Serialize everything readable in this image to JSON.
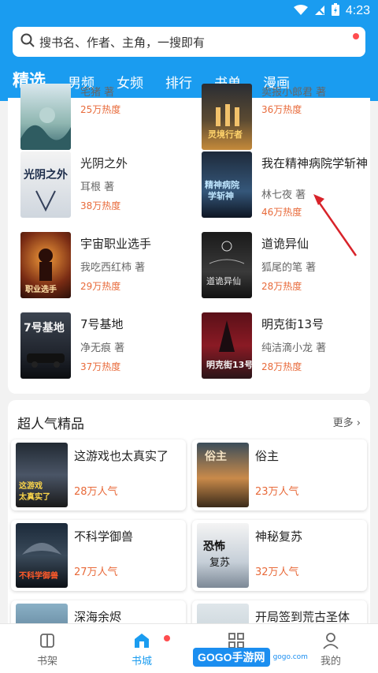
{
  "status_bar": {
    "time": "4:23"
  },
  "search": {
    "placeholder": "搜书名、作者、主角，一搜即有"
  },
  "tabs": [
    {
      "label": "精选",
      "active": true
    },
    {
      "label": "男频"
    },
    {
      "label": "女频"
    },
    {
      "label": "排行"
    },
    {
      "label": "书单"
    },
    {
      "label": "漫画"
    }
  ],
  "ranked_books": [
    {
      "title": "",
      "author": "宅猪 著",
      "heat": "25万热度"
    },
    {
      "title": "",
      "author": "卖报小郎君 著",
      "heat": "36万热度"
    },
    {
      "title": "光阴之外",
      "author": "耳根 著",
      "heat": "38万热度"
    },
    {
      "title": "我在精神病院学斩神",
      "author": "林七夜 著",
      "heat": "46万热度"
    },
    {
      "title": "宇宙职业选手",
      "author": "我吃西红柿 著",
      "heat": "29万热度"
    },
    {
      "title": "道诡异仙",
      "author": "狐尾的笔 著",
      "heat": "28万热度"
    },
    {
      "title": "7号基地",
      "author": "净无痕 著",
      "heat": "37万热度"
    },
    {
      "title": "明克街13号",
      "author": "纯洁滴小龙 著",
      "heat": "28万热度"
    }
  ],
  "popular_section": {
    "heading": "超人气精品",
    "more": "更多",
    "items": [
      {
        "title": "这游戏也太真实了",
        "heat": "28万人气"
      },
      {
        "title": "俗主",
        "heat": "23万人气"
      },
      {
        "title": "不科学御兽",
        "heat": "27万人气"
      },
      {
        "title": "神秘复苏",
        "heat": "32万人气"
      },
      {
        "title": "深海余烬",
        "heat": ""
      },
      {
        "title": "开局签到荒古圣体",
        "heat": ""
      }
    ]
  },
  "bottom_nav": [
    {
      "label": "书架",
      "icon": "bookshelf-icon"
    },
    {
      "label": "书城",
      "icon": "bookstore-icon",
      "active": true
    },
    {
      "label": "",
      "icon": "category-icon"
    },
    {
      "label": "我的",
      "icon": "profile-icon"
    }
  ],
  "watermark": {
    "brand": "GOGO手游网",
    "url": "gogo.com"
  },
  "colors": {
    "primary": "#1a9cf0",
    "heat": "#e86a3a",
    "badge": "#ff4d4f"
  }
}
